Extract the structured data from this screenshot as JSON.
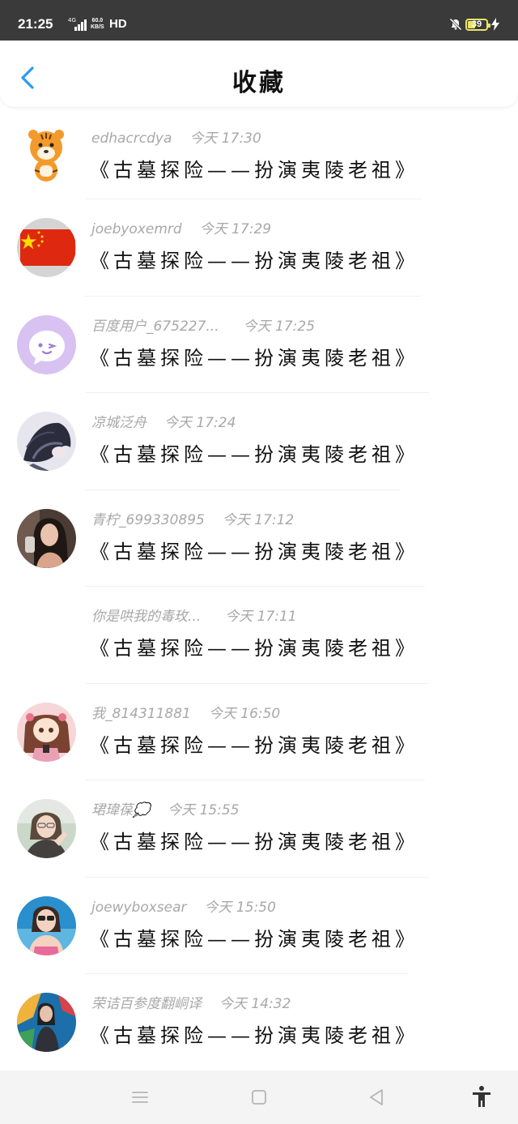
{
  "status_bar": {
    "time": "21:25",
    "network_type": "4G",
    "speed_value": "60.0",
    "speed_unit": "KB/S",
    "hd": "HD",
    "battery": "39",
    "battery_level": 0.39,
    "icons": [
      "signal-bars-icon",
      "mute-icon",
      "battery-icon",
      "charging-icon"
    ]
  },
  "header": {
    "title": "收藏",
    "back_icon": "chevron-left-icon",
    "accent_color": "#2b9af3"
  },
  "favorites": [
    {
      "name": "edhacrcdya",
      "time": "今天 17:30",
      "work": "《古墓探险——扮演夷陵老祖》",
      "avatar": "tiger-avatar"
    },
    {
      "name": "joebyoxemrd",
      "time": "今天 17:29",
      "work": "《古墓探险——扮演夷陵老祖》",
      "avatar": "flag-avatar"
    },
    {
      "name": "百度用户_675227...",
      "time": "今天 17:25",
      "work": "《古墓探险——扮演夷陵老祖》",
      "avatar": "default-chat-avatar"
    },
    {
      "name": "凉城泛舟",
      "time": "今天 17:24",
      "work": "《古墓探险——扮演夷陵老祖》",
      "avatar": "anime-avatar"
    },
    {
      "name": "青柠_699330895",
      "time": "今天 17:12",
      "work": "《古墓探险——扮演夷陵老祖》",
      "avatar": "photo-avatar"
    },
    {
      "name": "你是哄我的毒玫...",
      "time": "今天 17:11",
      "work": "《古墓探险——扮演夷陵老祖》",
      "avatar": "none"
    },
    {
      "name": "我_814311881",
      "time": "今天 16:50",
      "work": "《古墓探险——扮演夷陵老祖》",
      "avatar": "doll-avatar"
    },
    {
      "name": "珺瑋葆💭",
      "time": "今天 15:55",
      "work": "《古墓探险——扮演夷陵老祖》",
      "avatar": "girl-avatar"
    },
    {
      "name": "joewyboxsear",
      "time": "今天 15:50",
      "work": "《古墓探险——扮演夷陵老祖》",
      "avatar": "girl-avatar-2"
    },
    {
      "name": "荣诘百参度翻峒译",
      "time": "今天 14:32",
      "work": "《古墓探险——扮演夷陵老祖》",
      "avatar": "graffiti-avatar"
    }
  ],
  "nav_bar": {
    "icons": [
      "menu-icon",
      "home-square-icon",
      "back-triangle-icon",
      "accessibility-icon"
    ]
  }
}
